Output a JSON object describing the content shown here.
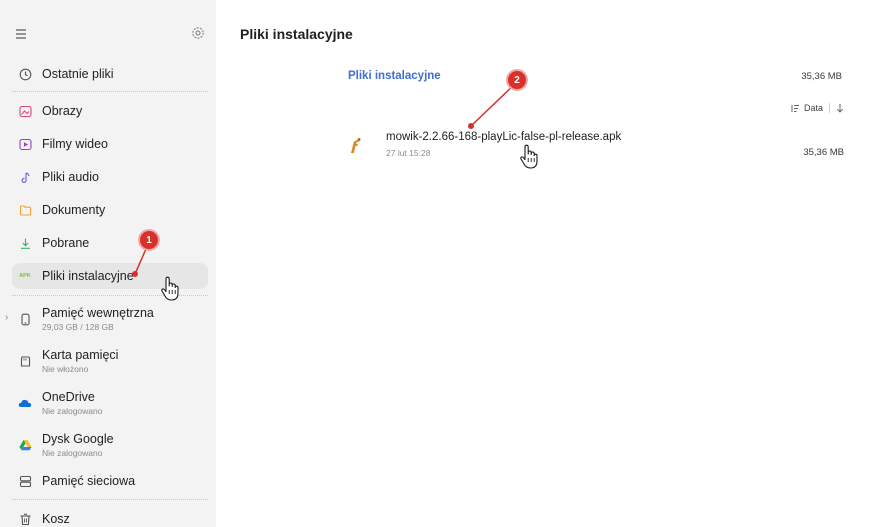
{
  "page_title": "Pliki instalacyjne",
  "sidebar": {
    "recent": "Ostatnie pliki",
    "images": "Obrazy",
    "videos": "Filmy wideo",
    "audio": "Pliki audio",
    "documents": "Dokumenty",
    "downloads": "Pobrane",
    "installation_files": "Pliki instalacyjne",
    "apk_tag": "APK",
    "internal_storage": {
      "label": "Pamięć wewnętrzna",
      "sub": "29,03 GB / 128 GB"
    },
    "memory_card": {
      "label": "Karta pamięci",
      "sub": "Nie włożono"
    },
    "onedrive": {
      "label": "OneDrive",
      "sub": "Nie zalogowano"
    },
    "google_drive": {
      "label": "Dysk Google",
      "sub": "Nie zalogowano"
    },
    "network_storage": "Pamięć sieciowa",
    "trash": "Kosz"
  },
  "main": {
    "section_title": "Pliki instalacyjne",
    "section_size": "35,36 MB",
    "sort_label": "Data",
    "files": [
      {
        "name": "mowik-2.2.66-168-playLic-false-pl-release.apk",
        "date": "27 lut 15:28",
        "size": "35,36 MB"
      }
    ]
  },
  "annotations": {
    "badge1": "1",
    "badge2": "2"
  },
  "colors": {
    "accent": "#3e6fd3",
    "badge": "#d9302c"
  }
}
